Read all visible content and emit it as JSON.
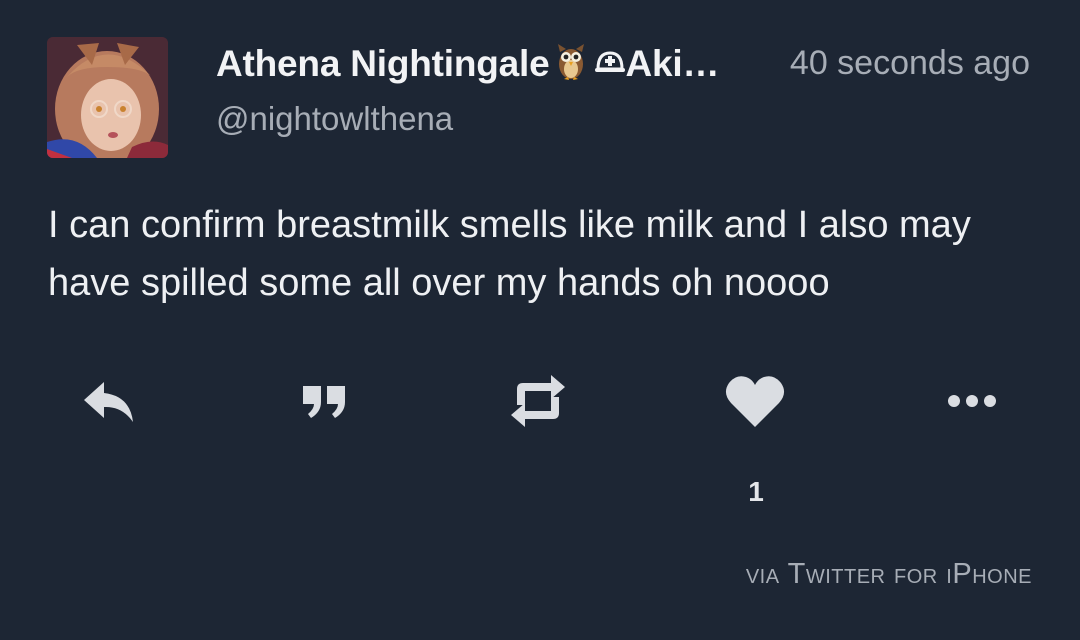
{
  "tweet": {
    "display_name": "Athena Nightingale",
    "display_name_suffix": "Aki…",
    "name_icons": [
      "owl-icon",
      "helmet-icon"
    ],
    "handle": "@nightowlthena",
    "timestamp": "40 seconds ago",
    "text": "I can confirm breastmilk smells like milk and I also may have spilled some all over my hands oh noooo",
    "like_count": "1",
    "source": "via Twitter for iPhone"
  },
  "actions": [
    {
      "name": "reply",
      "icon": "reply-icon"
    },
    {
      "name": "quote",
      "icon": "quote-icon"
    },
    {
      "name": "retweet",
      "icon": "retweet-icon"
    },
    {
      "name": "like",
      "icon": "heart-icon"
    },
    {
      "name": "more",
      "icon": "more-icon"
    }
  ],
  "colors": {
    "background": "#1d2634",
    "primary_text": "#eef0f3",
    "secondary_text": "#a7adb6",
    "icon": "#dadde2"
  }
}
